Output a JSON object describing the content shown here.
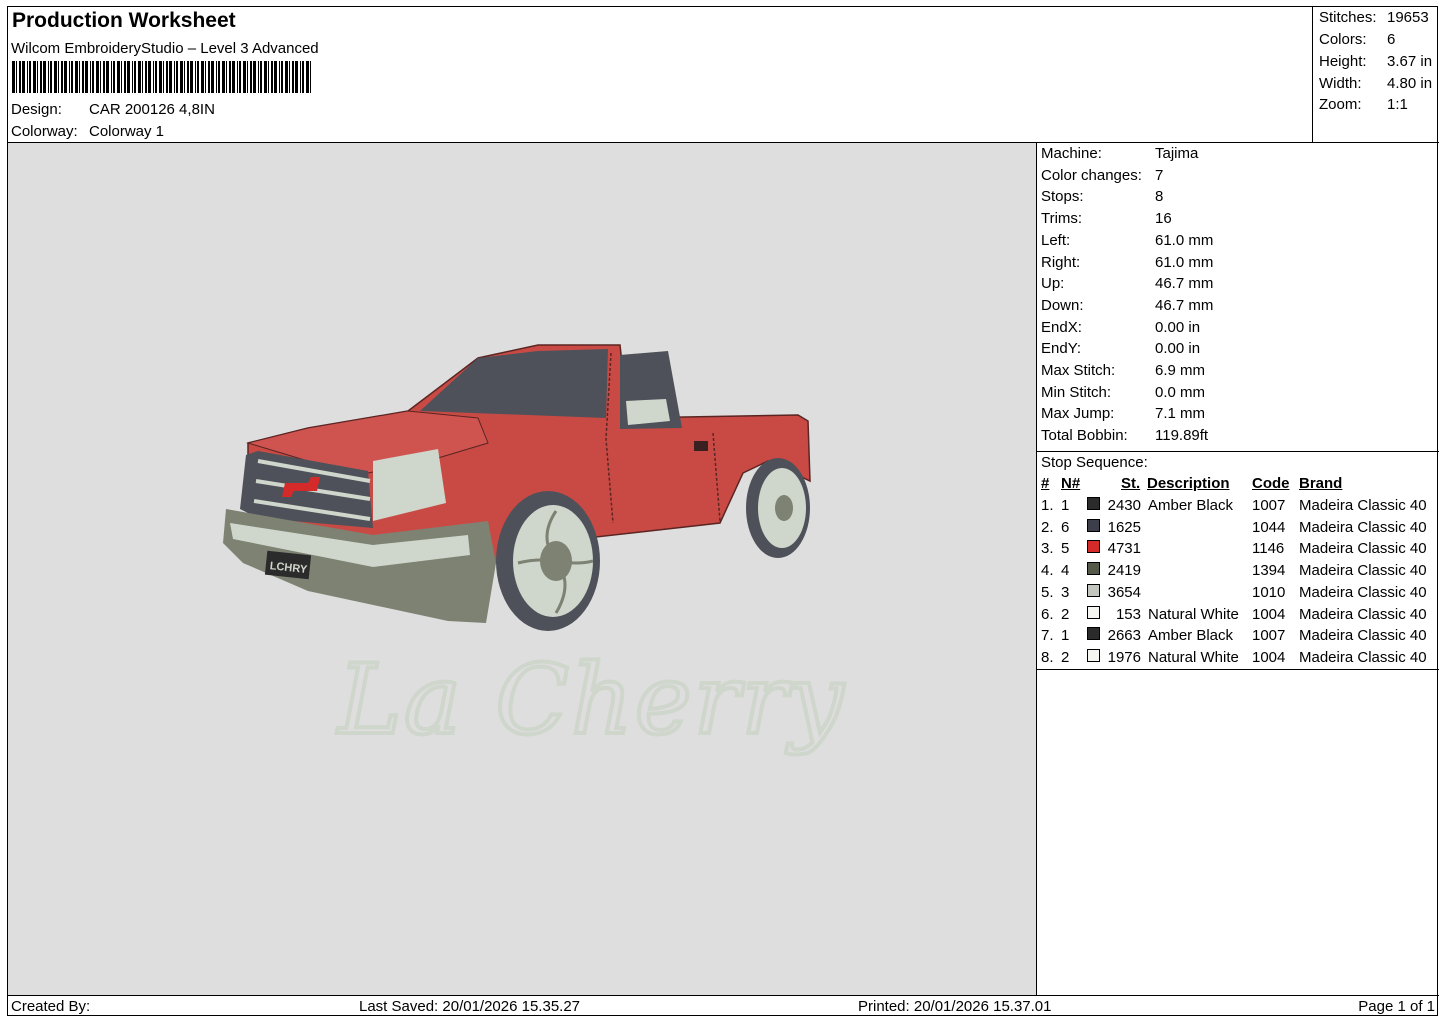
{
  "header": {
    "title": "Production Worksheet",
    "software": "Wilcom EmbroideryStudio – Level 3 Advanced",
    "design_label": "Design:",
    "design_value": "CAR 200126 4,8IN",
    "colorway_label": "Colorway:",
    "colorway_value": "Colorway 1"
  },
  "summary": [
    {
      "label": "Stitches:",
      "value": "19653"
    },
    {
      "label": "Colors:",
      "value": "6"
    },
    {
      "label": "Height:",
      "value": "3.67 in"
    },
    {
      "label": "Width:",
      "value": "4.80 in"
    },
    {
      "label": "Zoom:",
      "value": "1:1"
    }
  ],
  "machine_info": [
    {
      "label": "Machine:",
      "value": "Tajima"
    },
    {
      "label": "Color changes:",
      "value": "7"
    },
    {
      "label": "Stops:",
      "value": "8"
    },
    {
      "label": "Trims:",
      "value": "16"
    },
    {
      "label": "Left:",
      "value": "61.0 mm"
    },
    {
      "label": "Right:",
      "value": "61.0 mm"
    },
    {
      "label": "Up:",
      "value": "46.7 mm"
    },
    {
      "label": "Down:",
      "value": "46.7 mm"
    },
    {
      "label": "EndX:",
      "value": "0.00 in"
    },
    {
      "label": "EndY:",
      "value": "0.00 in"
    },
    {
      "label": "Max Stitch:",
      "value": "6.9 mm"
    },
    {
      "label": "Min Stitch:",
      "value": "0.0 mm"
    },
    {
      "label": "Max Jump:",
      "value": "7.1 mm"
    },
    {
      "label": "Total Bobbin:",
      "value": "119.89ft"
    }
  ],
  "stop_sequence": {
    "title": "Stop Sequence:",
    "headers": {
      "num": "#",
      "n": "N#",
      "st": "St.",
      "description": "Description",
      "code": "Code",
      "brand": "Brand"
    },
    "rows": [
      {
        "num": "1.",
        "n": "1",
        "st": "2430",
        "description": "Amber Black",
        "code": "1007",
        "brand": "Madeira Classic 40",
        "color": "#2b2b2b"
      },
      {
        "num": "2.",
        "n": "6",
        "st": "1625",
        "description": "",
        "code": "1044",
        "brand": "Madeira Classic 40",
        "color": "#3c3f4a"
      },
      {
        "num": "3.",
        "n": "5",
        "st": "4731",
        "description": "",
        "code": "1146",
        "brand": "Madeira Classic 40",
        "color": "#d42a2a"
      },
      {
        "num": "4.",
        "n": "4",
        "st": "2419",
        "description": "",
        "code": "1394",
        "brand": "Madeira Classic 40",
        "color": "#55594a"
      },
      {
        "num": "5.",
        "n": "3",
        "st": "3654",
        "description": "",
        "code": "1010",
        "brand": "Madeira Classic 40",
        "color": "#c3c6bf"
      },
      {
        "num": "6.",
        "n": "2",
        "st": "153",
        "description": "Natural White",
        "code": "1004",
        "brand": "Madeira Classic 40",
        "color": "#f5f5f2"
      },
      {
        "num": "7.",
        "n": "1",
        "st": "2663",
        "description": "Amber Black",
        "code": "1007",
        "brand": "Madeira Classic 40",
        "color": "#2b2b2b"
      },
      {
        "num": "8.",
        "n": "2",
        "st": "1976",
        "description": "Natural White",
        "code": "1004",
        "brand": "Madeira Classic 40",
        "color": "#f5f5f2"
      }
    ]
  },
  "design_preview": {
    "script_text": "La Cherry",
    "plate_text": "LCHRY",
    "body_color": "#c94a44",
    "window_color": "#4e5159",
    "bumper_color": "#7d8272",
    "chrome_color": "#cfd6cb"
  },
  "footer": {
    "created_by": "Created By:",
    "last_saved": "Last Saved: 20/01/2026 15.35.27",
    "printed": "Printed: 20/01/2026 15.37.01",
    "page": "Page 1 of 1"
  }
}
